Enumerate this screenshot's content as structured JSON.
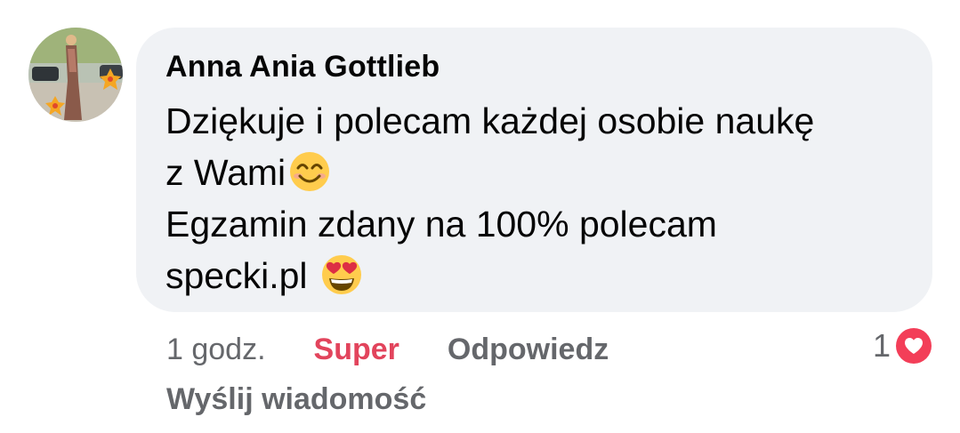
{
  "comment": {
    "author": "Anna Ania Gottlieb",
    "lines": [
      "Dziękuje i polecam każdej osobie naukę",
      "z Wami",
      "Egzamin zdany na 100% polecam",
      "specki.pl "
    ],
    "emojis": [
      "smiling-face-icon",
      "heart-eyes-icon"
    ]
  },
  "actions": {
    "time": "1 godz.",
    "react_label": "Super",
    "reply_label": "Odpowiedz",
    "send_message_label": "Wyślij wiadomość"
  },
  "reactions": {
    "count": "1",
    "type": "love-icon"
  },
  "colors": {
    "bubble": "#f0f2f5",
    "react_active": "#e2445c",
    "meta_text": "#65676b",
    "love": "#f33e58"
  }
}
